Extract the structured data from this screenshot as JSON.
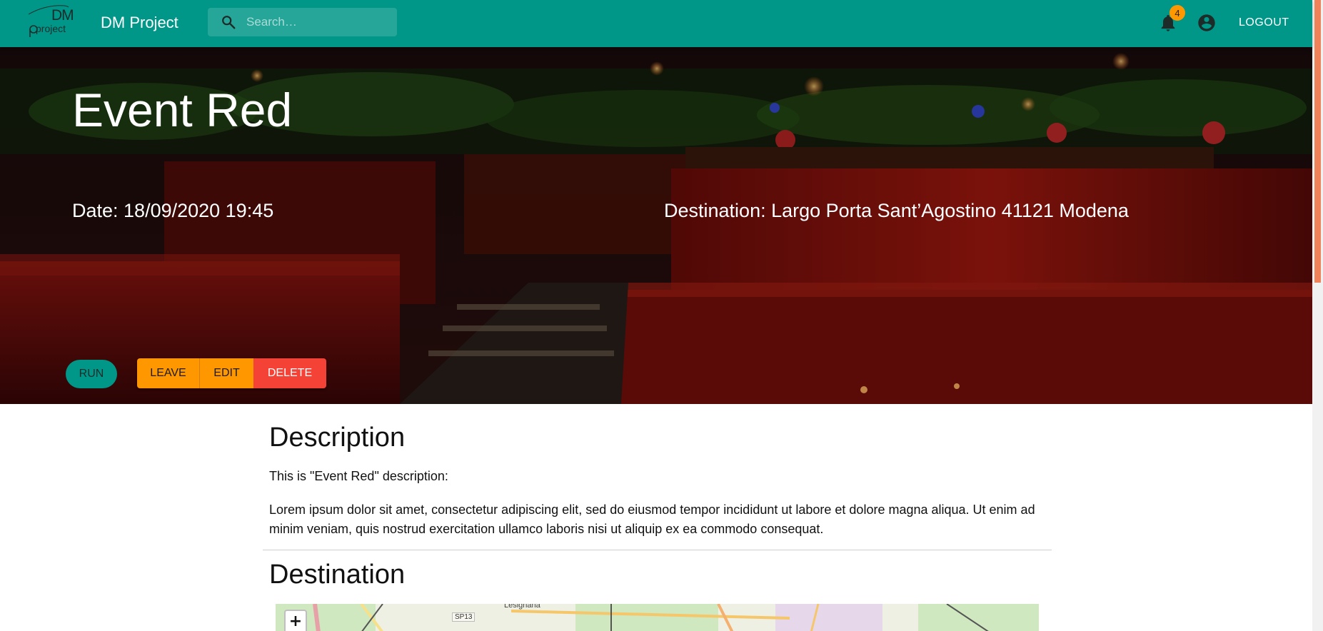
{
  "app": {
    "logo_text_top": "DM",
    "logo_text_bottom": "project",
    "title": "DM Project",
    "search_placeholder": "Search…",
    "notifications_count": "4",
    "logout_label": "LOGOUT",
    "brand_color": "#009688"
  },
  "event": {
    "title": "Event Red",
    "date_text": "Date: 18/09/2020 19:45",
    "destination_text": "Destination: Largo Porta Sant’Agostino 41121 Modena",
    "actions": {
      "run": "RUN",
      "leave": "LEAVE",
      "edit": "EDIT",
      "delete": "DELETE"
    },
    "action_colors": {
      "run": "#009688",
      "warning": "#ff9800",
      "danger": "#f44336"
    }
  },
  "description": {
    "heading": "Description",
    "intro": "This is \"Event Red\" description:",
    "body": "Lorem ipsum dolor sit amet, consectetur adipiscing elit, sed do eiusmod tempor incididunt ut labore et dolore magna aliqua. Ut enim ad minim veniam, quis nostrud exercitation ullamco laboris nisi ut aliquip ex ea commodo consequat."
  },
  "destination": {
    "heading": "Destination",
    "map": {
      "zoom_in_label": "+",
      "road_label": "SP13",
      "town_label": "Lesignana"
    }
  },
  "icons": {
    "search": "search-icon",
    "notifications": "bell-icon",
    "account": "account-circle-icon",
    "zoom": "plus-icon"
  }
}
